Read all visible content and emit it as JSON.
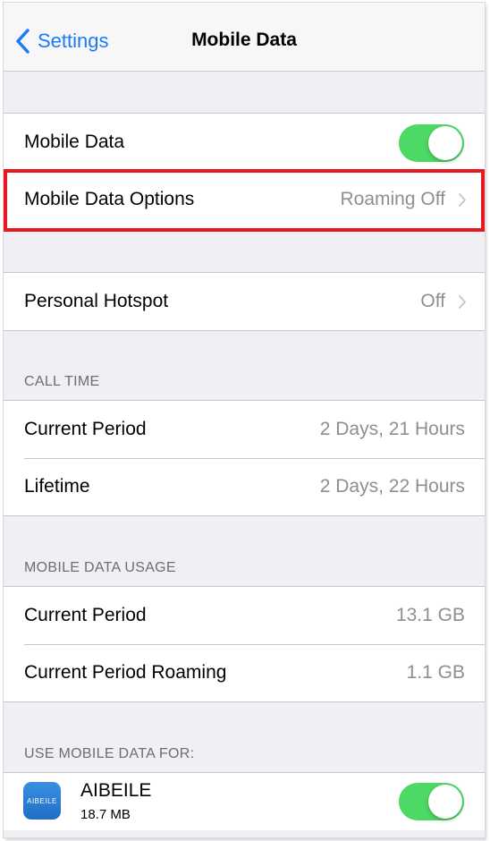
{
  "navbar": {
    "back_label": "Settings",
    "title": "Mobile Data"
  },
  "group1": {
    "mobile_data": {
      "label": "Mobile Data",
      "toggle_on": true
    },
    "options": {
      "label": "Mobile Data Options",
      "value": "Roaming Off"
    }
  },
  "group2": {
    "hotspot": {
      "label": "Personal Hotspot",
      "value": "Off"
    }
  },
  "call_time": {
    "header": "CALL TIME",
    "rows": [
      {
        "label": "Current Period",
        "value": "2 Days, 21 Hours"
      },
      {
        "label": "Lifetime",
        "value": "2 Days, 22 Hours"
      }
    ]
  },
  "data_usage": {
    "header": "MOBILE DATA USAGE",
    "rows": [
      {
        "label": "Current Period",
        "value": "13.1 GB"
      },
      {
        "label": "Current Period Roaming",
        "value": "1.1 GB"
      }
    ]
  },
  "use_for": {
    "header": "USE MOBILE DATA FOR:",
    "apps": [
      {
        "icon_text": "AIBEILE",
        "name": "AIBEILE",
        "usage": "18.7 MB",
        "toggle_on": true
      }
    ]
  },
  "colors": {
    "accent": "#1a7cf5",
    "toggle_on": "#4cd964",
    "highlight": "#e5191f"
  },
  "icons": {
    "back": "chevron-left-icon",
    "disclosure": "chevron-right-icon"
  }
}
